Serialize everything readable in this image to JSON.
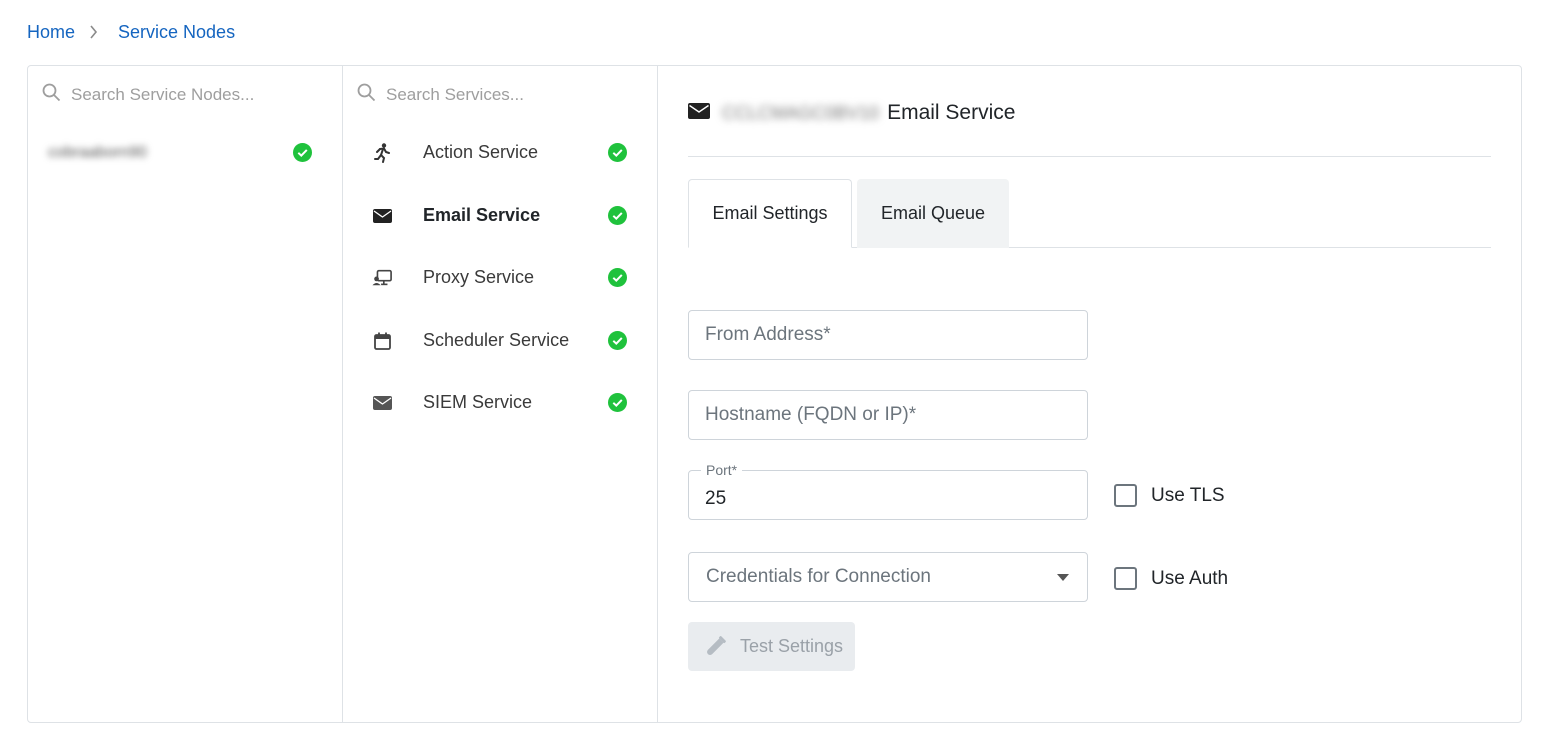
{
  "breadcrumb": {
    "home": "Home",
    "current": "Service Nodes"
  },
  "nodes": {
    "search_placeholder": "Search Service Nodes...",
    "items": [
      {
        "name": "cobraaborn90",
        "status": "ok"
      }
    ]
  },
  "services": {
    "search_placeholder": "Search Services...",
    "items": [
      {
        "label": "Action Service",
        "icon": "running-person-icon",
        "status": "ok"
      },
      {
        "label": "Email Service",
        "icon": "envelope-icon",
        "status": "ok",
        "active": true
      },
      {
        "label": "Proxy Service",
        "icon": "proxy-icon",
        "status": "ok"
      },
      {
        "label": "Scheduler Service",
        "icon": "calendar-icon",
        "status": "ok"
      },
      {
        "label": "SIEM Service",
        "icon": "envelope-icon",
        "status": "ok"
      }
    ]
  },
  "detail": {
    "node_name": "CCLCMAGC0BV10",
    "title": "Email Service",
    "tabs": [
      {
        "label": "Email Settings",
        "active": true
      },
      {
        "label": "Email Queue",
        "active": false
      }
    ],
    "form": {
      "from_placeholder": "From Address*",
      "hostname_placeholder": "Hostname (FQDN or IP)*",
      "port_label": "Port*",
      "port_value": "25",
      "use_tls_label": "Use TLS",
      "credentials_placeholder": "Credentials for Connection",
      "use_auth_label": "Use Auth",
      "test_button": "Test Settings"
    }
  },
  "colors": {
    "link": "#1565c0",
    "status_ok": "#1fc23c",
    "border": "#dee2e6"
  }
}
